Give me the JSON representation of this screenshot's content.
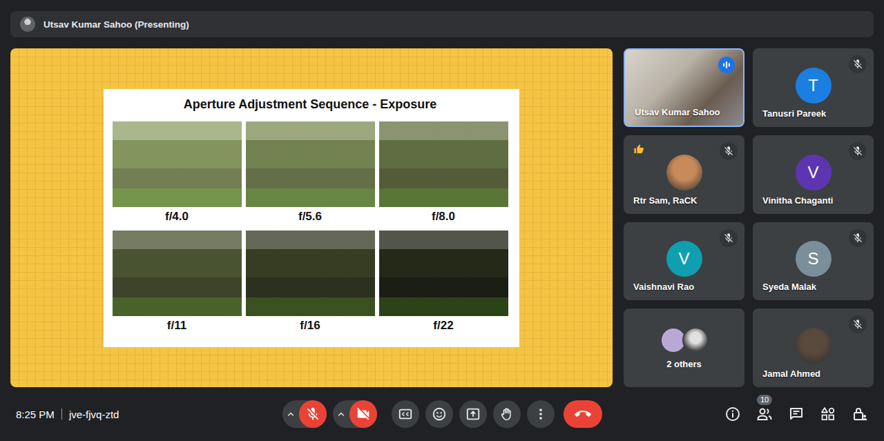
{
  "presenting_bar": {
    "label": "Utsav Kumar Sahoo (Presenting)"
  },
  "slide": {
    "title": "Aperture Adjustment Sequence - Exposure",
    "photos": [
      {
        "label": "f/4.0",
        "color": "#93a36a"
      },
      {
        "label": "f/5.6",
        "color": "#808e5c"
      },
      {
        "label": "f/8.0",
        "color": "#6a7549"
      },
      {
        "label": "f/11",
        "color": "#4f5736"
      },
      {
        "label": "f/16",
        "color": "#383d26"
      },
      {
        "label": "f/22",
        "color": "#232619"
      }
    ]
  },
  "participants": [
    {
      "name": "Utsav Kumar Sahoo",
      "kind": "video",
      "initial": "",
      "color": "#8ab4f8",
      "muted": false,
      "speaking": true,
      "reaction": false
    },
    {
      "name": "Tanusri Pareek",
      "kind": "initial",
      "initial": "T",
      "color": "#1a7fe0",
      "muted": true,
      "speaking": false,
      "reaction": false
    },
    {
      "name": "Rtr Sam, RaCK",
      "kind": "photo",
      "initial": "",
      "color": "#c98a5a",
      "muted": true,
      "speaking": false,
      "reaction": true
    },
    {
      "name": "Vinitha Chaganti",
      "kind": "initial",
      "initial": "V",
      "color": "#5e35b1",
      "muted": true,
      "speaking": false,
      "reaction": false
    },
    {
      "name": "Vaishnavi Rao",
      "kind": "initial",
      "initial": "V",
      "color": "#0f9fb0",
      "muted": true,
      "speaking": false,
      "reaction": false
    },
    {
      "name": "Syeda Malak",
      "kind": "initial",
      "initial": "S",
      "color": "#7a8f99",
      "muted": true,
      "speaking": false,
      "reaction": false
    },
    {
      "name": "2 others",
      "kind": "group",
      "initial": "",
      "color": "#b9a7d6",
      "muted": false,
      "speaking": false,
      "reaction": false
    },
    {
      "name": "Jamal Ahmed",
      "kind": "photo",
      "initial": "",
      "color": "#5a4a3e",
      "muted": true,
      "speaking": false,
      "reaction": false
    }
  ],
  "meeting": {
    "time": "8:25 PM",
    "code": "jve-fjvq-ztd"
  },
  "controls": {
    "mic_muted": true,
    "camera_off": true
  },
  "people_count": "10"
}
